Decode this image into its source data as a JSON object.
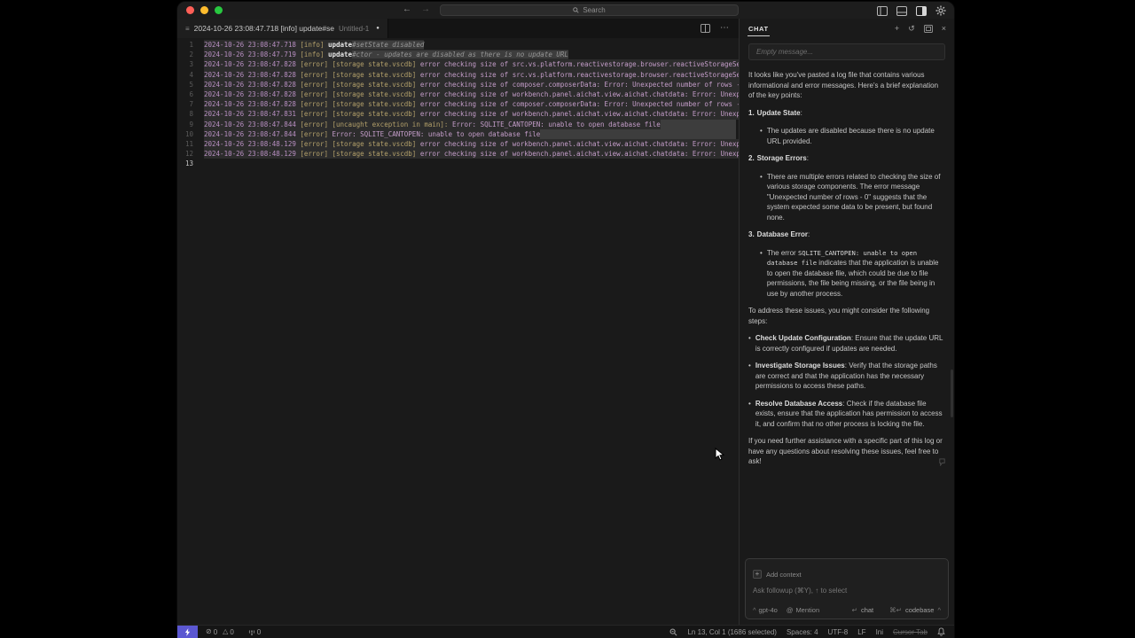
{
  "title_bar": {
    "search_placeholder": "Search"
  },
  "editor_tab": {
    "label": "2024-10-26 23:08:47.718 [info] update#se",
    "description": "Untitled-1",
    "dirty": true
  },
  "editor": {
    "lines": [
      {
        "num": "1",
        "selected": true,
        "parts": [
          {
            "t": "2024-10-26 23:08:47.718 ",
            "c": "ts"
          },
          {
            "t": "[info] ",
            "c": "tag"
          },
          {
            "t": "update",
            "c": "strong"
          },
          {
            "t": "#setState disabled",
            "c": "dimhl"
          }
        ]
      },
      {
        "num": "2",
        "selected": true,
        "parts": [
          {
            "t": "2024-10-26 23:08:47.719 ",
            "c": "ts"
          },
          {
            "t": "[info] ",
            "c": "tag"
          },
          {
            "t": "update",
            "c": "strong"
          },
          {
            "t": "#ctor - updates are disabled as there is no update URL",
            "c": "dimhl"
          }
        ]
      },
      {
        "num": "3",
        "selected": true,
        "parts": [
          {
            "t": "2024-10-26 23:08:47.828 ",
            "c": "ts"
          },
          {
            "t": "[error] ",
            "c": "tag"
          },
          {
            "t": "[storage state.vscdb] ",
            "c": "tag"
          },
          {
            "t": "error checking size of src.vs.platform.reactivestorage.browser.reactiveStorageSe",
            "c": "msg"
          }
        ]
      },
      {
        "num": "4",
        "selected": true,
        "parts": [
          {
            "t": "2024-10-26 23:08:47.828 ",
            "c": "ts"
          },
          {
            "t": "[error] ",
            "c": "tag"
          },
          {
            "t": "[storage state.vscdb] ",
            "c": "tag"
          },
          {
            "t": "error checking size of src.vs.platform.reactivestorage.browser.reactiveStorageSe",
            "c": "msg"
          }
        ]
      },
      {
        "num": "5",
        "selected": true,
        "parts": [
          {
            "t": "2024-10-26 23:08:47.828 ",
            "c": "ts"
          },
          {
            "t": "[error] ",
            "c": "tag"
          },
          {
            "t": "[storage state.vscdb] ",
            "c": "tag"
          },
          {
            "t": "error checking size of composer.composerData: Error: Unexpected number of rows -",
            "c": "msg"
          }
        ]
      },
      {
        "num": "6",
        "selected": true,
        "parts": [
          {
            "t": "2024-10-26 23:08:47.828 ",
            "c": "ts"
          },
          {
            "t": "[error] ",
            "c": "tag"
          },
          {
            "t": "[storage state.vscdb] ",
            "c": "tag"
          },
          {
            "t": "error checking size of workbench.panel.aichat.view.aichat.chatdata: Error: Unexp",
            "c": "msg"
          }
        ]
      },
      {
        "num": "7",
        "selected": true,
        "parts": [
          {
            "t": "2024-10-26 23:08:47.828 ",
            "c": "ts"
          },
          {
            "t": "[error] ",
            "c": "tag"
          },
          {
            "t": "[storage state.vscdb] ",
            "c": "tag"
          },
          {
            "t": "error checking size of composer.composerData: Error: Unexpected number of rows -",
            "c": "msg"
          }
        ]
      },
      {
        "num": "8",
        "selected": true,
        "parts": [
          {
            "t": "2024-10-26 23:08:47.831 ",
            "c": "ts"
          },
          {
            "t": "[error] ",
            "c": "tag"
          },
          {
            "t": "[storage state.vscdb] ",
            "c": "tag"
          },
          {
            "t": "error checking size of workbench.panel.aichat.view.aichat.chatdata: Error: Unexp",
            "c": "msg"
          }
        ]
      },
      {
        "num": "9",
        "selected": true,
        "trail": true,
        "parts": [
          {
            "t": "2024-10-26 23:08:47.844 ",
            "c": "ts"
          },
          {
            "t": "[error] ",
            "c": "tag"
          },
          {
            "t": "[uncaught exception in main]: ",
            "c": "tag"
          },
          {
            "t": "Error: SQLITE_CANTOPEN: unable to open database file",
            "c": "msg"
          }
        ]
      },
      {
        "num": "10",
        "selected": true,
        "trail": true,
        "parts": [
          {
            "t": "2024-10-26 23:08:47.844 ",
            "c": "ts"
          },
          {
            "t": "[error] ",
            "c": "tag"
          },
          {
            "t": "Error: SQLITE_CANTOPEN: unable to open database file",
            "c": "msg"
          }
        ]
      },
      {
        "num": "11",
        "selected": true,
        "parts": [
          {
            "t": "2024-10-26 23:08:48.129 ",
            "c": "ts"
          },
          {
            "t": "[error] ",
            "c": "tag"
          },
          {
            "t": "[storage state.vscdb] ",
            "c": "tag"
          },
          {
            "t": "error checking size of workbench.panel.aichat.view.aichat.chatdata: Error: Unexp",
            "c": "msg"
          }
        ]
      },
      {
        "num": "12",
        "selected": true,
        "parts": [
          {
            "t": "2024-10-26 23:08:48.129 ",
            "c": "ts"
          },
          {
            "t": "[error] ",
            "c": "tag"
          },
          {
            "t": "[storage state.vscdb] ",
            "c": "tag"
          },
          {
            "t": "error checking size of workbench.panel.aichat.view.aichat.chatdata: Error: Unexp",
            "c": "msg"
          }
        ]
      },
      {
        "num": "13",
        "active": true,
        "parts": []
      }
    ]
  },
  "chat": {
    "tab_label": "CHAT",
    "empty_message_placeholder": "Empty message...",
    "message": {
      "blocks": [
        {
          "type": "p",
          "segments": [
            {
              "t": "It looks like you've pasted a log file that contains various informational and error messages. Here's a brief explanation of the key points:"
            }
          ]
        },
        {
          "type": "num",
          "n": "1.",
          "segments": [
            {
              "t": "Update State",
              "b": true
            },
            {
              "t": ":"
            }
          ]
        },
        {
          "type": "bullet",
          "indent": true,
          "segments": [
            {
              "t": "The updates are disabled because there is no update URL provided."
            }
          ]
        },
        {
          "type": "num",
          "n": "2.",
          "segments": [
            {
              "t": "Storage Errors",
              "b": true
            },
            {
              "t": ":"
            }
          ]
        },
        {
          "type": "bullet",
          "indent": true,
          "segments": [
            {
              "t": "There are multiple errors related to checking the size of various storage components. The error message \"Unexpected number of rows - 0\" suggests that the system expected some data to be present, but found none."
            }
          ]
        },
        {
          "type": "num",
          "n": "3.",
          "segments": [
            {
              "t": "Database Error",
              "b": true
            },
            {
              "t": ":"
            }
          ]
        },
        {
          "type": "bullet",
          "indent": true,
          "segments": [
            {
              "t": "The error "
            },
            {
              "t": "SQLITE_CANTOPEN: unable to open database file",
              "code": true
            },
            {
              "t": " indicates that the application is unable to open the database file, which could be due to file permissions, the file being missing, or the file being in use by another process."
            }
          ]
        },
        {
          "type": "p",
          "segments": [
            {
              "t": "To address these issues, you might consider the following steps:"
            }
          ]
        },
        {
          "type": "bullet",
          "segments": [
            {
              "t": "Check Update Configuration",
              "b": true
            },
            {
              "t": ": Ensure that the update URL is correctly configured if updates are needed."
            }
          ]
        },
        {
          "type": "bullet",
          "segments": [
            {
              "t": "Investigate Storage Issues",
              "b": true
            },
            {
              "t": ": Verify that the storage paths are correct and that the application has the necessary permissions to access these paths."
            }
          ]
        },
        {
          "type": "bullet",
          "segments": [
            {
              "t": "Resolve Database Access",
              "b": true
            },
            {
              "t": ": Check if the database file exists, ensure that the application has permission to access it, and confirm that no other process is locking the file."
            }
          ]
        },
        {
          "type": "p",
          "segments": [
            {
              "t": "If you need further assistance with a specific part of this log or have any questions about resolving these issues, feel free to ask!"
            }
          ]
        }
      ]
    },
    "footer": {
      "add_context": "Add context",
      "followup_placeholder": "Ask followup (⌘Y), ↑ to select",
      "model": "gpt-4o",
      "mention": "Mention",
      "chat_hint": "chat",
      "codebase_hint": "codebase",
      "enter_key": "↵",
      "cmd_enter_key": "⌘↵",
      "chevron": "^"
    }
  },
  "status_bar": {
    "errors": "0",
    "warnings": "0",
    "ports": "0",
    "cursor_position": "Ln 13, Col 1 (1686 selected)",
    "indentation": "Spaces: 4",
    "encoding": "UTF-8",
    "eol": "LF",
    "language": "Ini",
    "cursor_tab": "Cursor Tab"
  },
  "glyphs": {
    "back_arrow": "←",
    "forward_arrow": "→",
    "file_icon": "≡",
    "dirty_dot": "●",
    "more_ellipsis": "⋯",
    "plus": "+",
    "history": "↺",
    "close": "×",
    "error_circle": "⊘",
    "warning_triangle": "△",
    "mention_at": "@"
  },
  "colors": {
    "accent_remote": "#5b57d1",
    "timestamp": "#b88fc2",
    "log_tag": "#b3a06a",
    "log_message": "#c49dc9",
    "selection": "#2c2c2c",
    "traffic_red": "#ff5f57",
    "traffic_yellow": "#febc2e",
    "traffic_green": "#28c840"
  }
}
